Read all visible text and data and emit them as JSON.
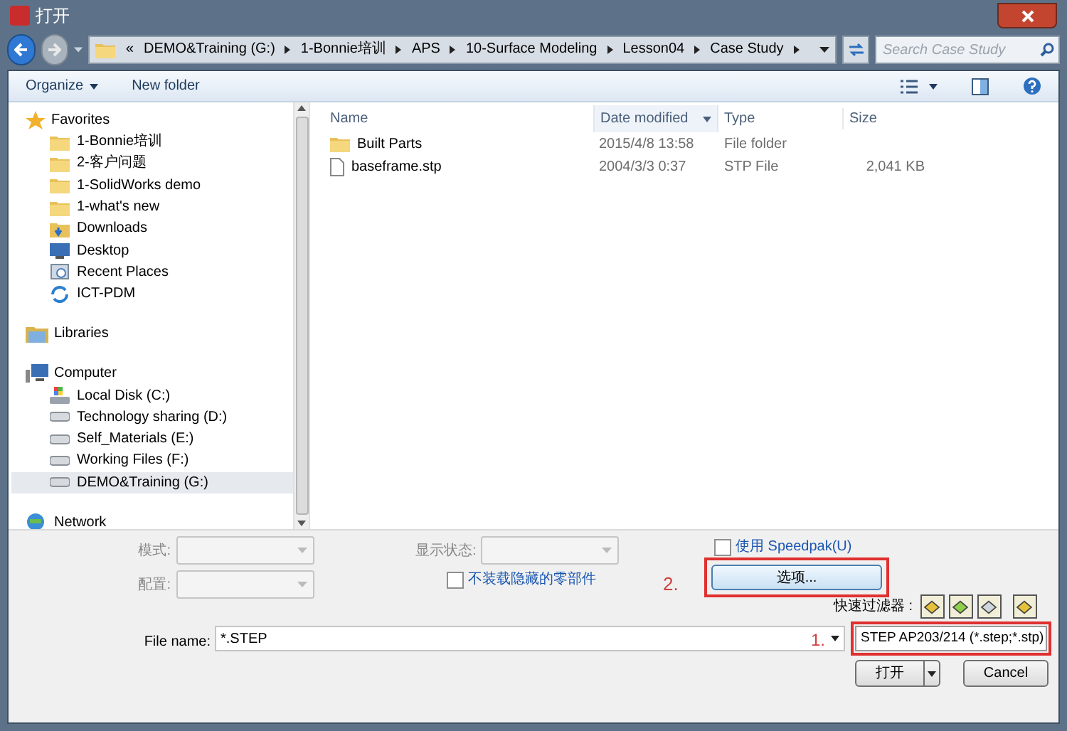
{
  "window": {
    "title": "打开"
  },
  "address": {
    "overflow": "«",
    "crumbs": [
      "DEMO&Training (G:)",
      "1-Bonnie培训",
      "APS",
      "10-Surface Modeling",
      "Lesson04",
      "Case Study"
    ]
  },
  "search": {
    "placeholder": "Search Case Study"
  },
  "toolbar": {
    "organize": "Organize",
    "new_folder": "New folder"
  },
  "sidebar": {
    "groups": [
      {
        "label": "Favorites",
        "kind": "favorites",
        "items": [
          {
            "label": "1-Bonnie培训",
            "kind": "folder",
            "selected": false
          },
          {
            "label": "2-客户问题",
            "kind": "folder",
            "selected": false
          },
          {
            "label": "1-SolidWorks demo",
            "kind": "folder",
            "selected": false
          },
          {
            "label": "1-what's new",
            "kind": "folder",
            "selected": false
          },
          {
            "label": "Downloads",
            "kind": "downloads",
            "selected": false
          },
          {
            "label": "Desktop",
            "kind": "desktop",
            "selected": false
          },
          {
            "label": "Recent Places",
            "kind": "recent",
            "selected": false
          },
          {
            "label": "ICT-PDM",
            "kind": "sync",
            "selected": false
          }
        ]
      },
      {
        "label": "Libraries",
        "kind": "libraries"
      },
      {
        "label": "Computer",
        "kind": "computer",
        "items": [
          {
            "label": "Local Disk (C:)",
            "kind": "sysdrive",
            "selected": false
          },
          {
            "label": "Technology sharing (D:)",
            "kind": "drive",
            "selected": false
          },
          {
            "label": "Self_Materials (E:)",
            "kind": "drive",
            "selected": false
          },
          {
            "label": "Working Files (F:)",
            "kind": "drive",
            "selected": false
          },
          {
            "label": "DEMO&Training (G:)",
            "kind": "drive",
            "selected": true
          }
        ]
      },
      {
        "label": "Network",
        "kind": "network"
      }
    ]
  },
  "table": {
    "columns": [
      "Name",
      "Date modified",
      "Type",
      "Size"
    ],
    "rows": [
      {
        "kind": "folder",
        "name": "Built Parts",
        "date": "2015/4/8 13:58",
        "type": "File folder",
        "size": ""
      },
      {
        "kind": "file",
        "name": "baseframe.stp",
        "date": "2004/3/3 0:37",
        "type": "STP File",
        "size": "2,041 KB"
      }
    ]
  },
  "options": {
    "mode_label": "模式:",
    "config_label": "配置:",
    "display_state_label": "显示状态:",
    "speedpak": {
      "label": "使用 Speedpak(U)",
      "checked": false
    },
    "hidden": {
      "label": "不装载隐藏的零部件",
      "checked": false
    },
    "options_button": "选项...",
    "quick_filter_label": "快速过滤器 :"
  },
  "file_name": {
    "label": "File name:",
    "value": "*.STEP"
  },
  "file_type": {
    "value": "STEP AP203/214 (*.step;*.stp)"
  },
  "annotations": [
    "1.",
    "2."
  ],
  "buttons": {
    "open": "打开",
    "cancel": "Cancel"
  }
}
